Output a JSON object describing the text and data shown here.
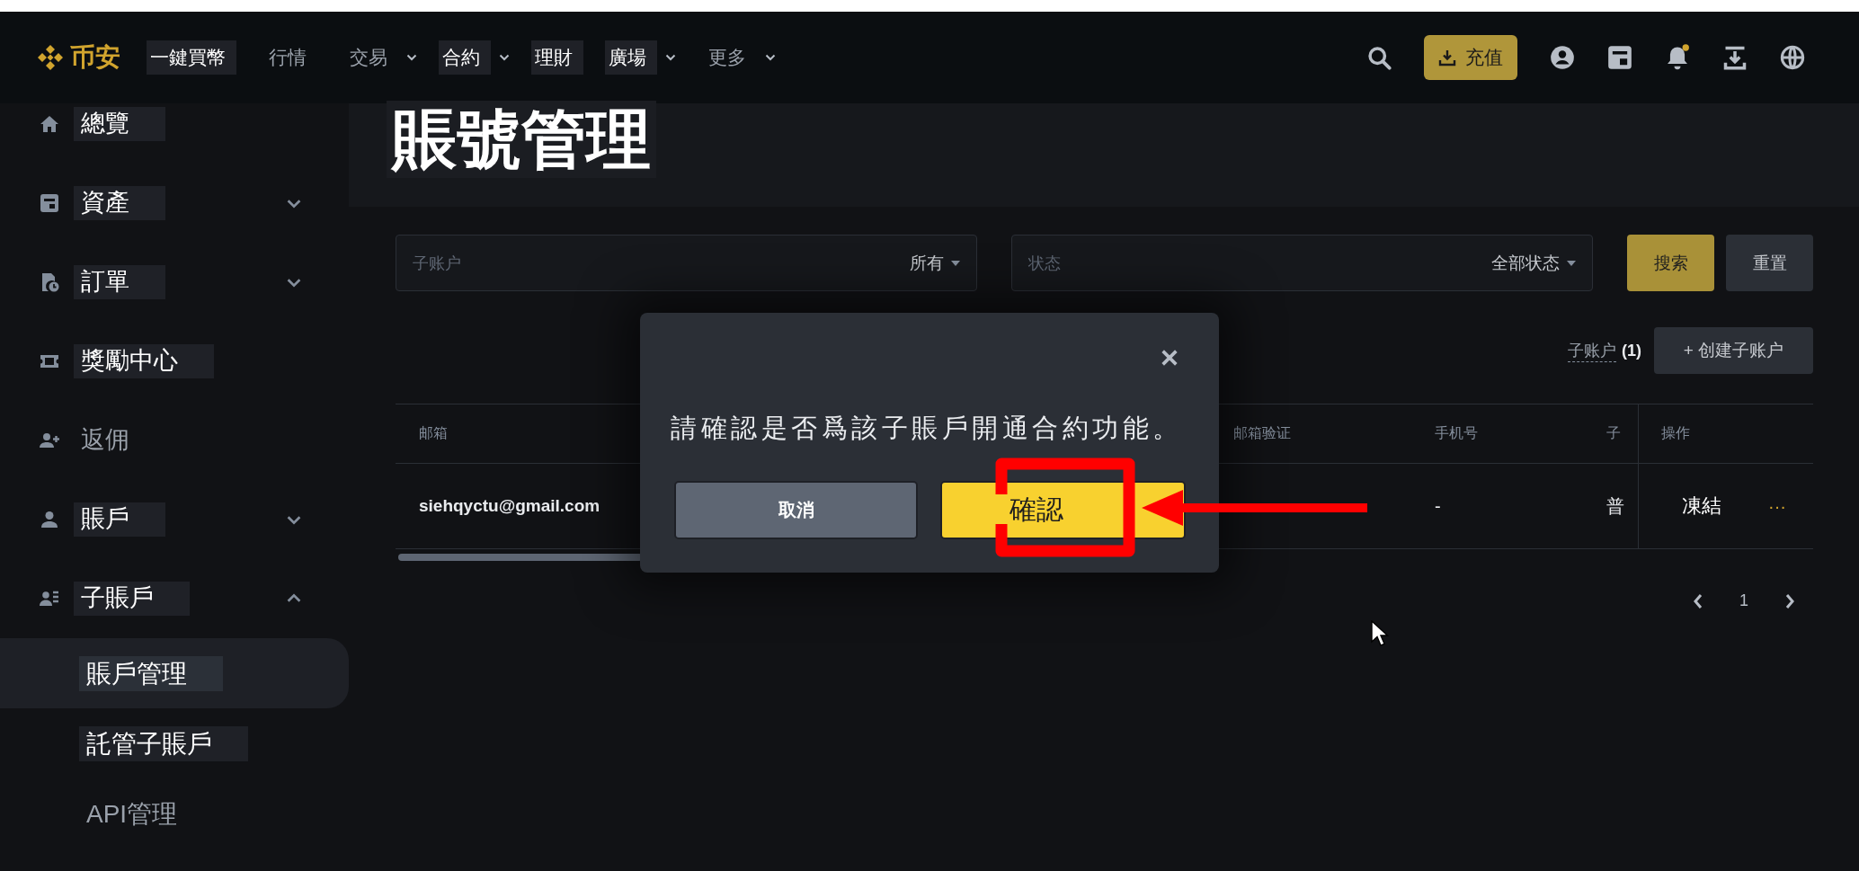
{
  "top_nav": {
    "logo": "币安",
    "items": [
      {
        "label": "一鍵買幣",
        "boxed": true,
        "dropdown": false
      },
      {
        "label": "行情",
        "boxed": false,
        "dropdown": false
      },
      {
        "label": "交易",
        "boxed": false,
        "dropdown": true
      },
      {
        "label": "合約",
        "boxed": true,
        "dropdown": true
      },
      {
        "label": "理財",
        "boxed": true,
        "dropdown": false
      },
      {
        "label": "廣場",
        "boxed": true,
        "dropdown": true
      },
      {
        "label": "更多",
        "boxed": false,
        "dropdown": true
      }
    ],
    "deposit_button": "充值",
    "notification_dot": true
  },
  "sidebar": {
    "items": [
      {
        "label": "總覽",
        "kind": "link",
        "boxed": true
      },
      {
        "label": "資產",
        "kind": "group",
        "boxed": true,
        "expanded": false
      },
      {
        "label": "訂單",
        "kind": "group",
        "boxed": true,
        "expanded": false
      },
      {
        "label": "獎勵中心",
        "kind": "link",
        "boxed": true
      },
      {
        "label": "返佣",
        "kind": "link",
        "boxed": false
      },
      {
        "label": "賬戶",
        "kind": "group",
        "boxed": true,
        "expanded": false
      },
      {
        "label": "子賬戶",
        "kind": "group",
        "boxed": true,
        "expanded": true,
        "children": [
          {
            "label": "賬戶管理",
            "boxed": true,
            "selected": true
          },
          {
            "label": "託管子賬戶",
            "boxed": true,
            "selected": false
          },
          {
            "label": "API管理",
            "boxed": false,
            "selected": false
          }
        ]
      }
    ]
  },
  "page_title": "賬號管理",
  "filters": [
    {
      "label": "子账户",
      "value": "所有"
    },
    {
      "label": "状态",
      "value": "全部状态"
    }
  ],
  "filter_buttons": [
    {
      "label": "搜索",
      "kind": "primary"
    },
    {
      "label": "重置",
      "kind": "secondary"
    }
  ],
  "toolbar": {
    "count_label": "子账户",
    "count": "(1)",
    "create_button": "+ 创建子账户"
  },
  "table": {
    "columns": [
      "邮箱",
      "邮箱验证",
      "手机号",
      "子",
      "操作"
    ],
    "rows": [
      {
        "email": "siehqyctu@gmail.com",
        "phone": "-",
        "column_4": "普",
        "action": "凍結",
        "more": "···"
      }
    ]
  },
  "pagination": {
    "page": "1"
  },
  "dialog": {
    "message": "請確認是否爲該子賬戶開通合約功能。",
    "cancel_button": "取消",
    "confirm_button": "確認"
  }
}
